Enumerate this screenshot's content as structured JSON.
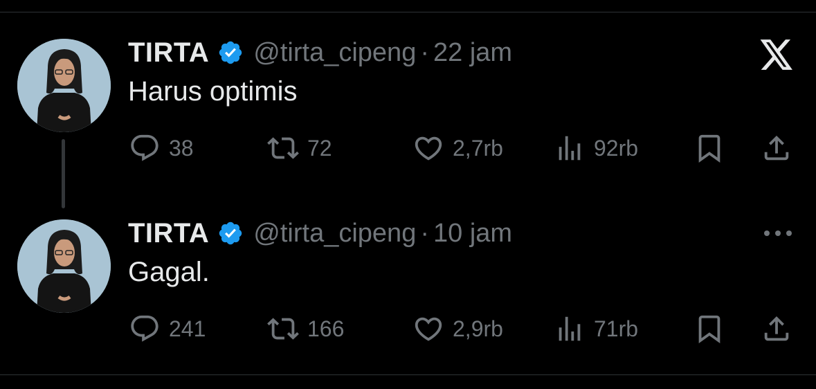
{
  "tweets": [
    {
      "author_name": "TIRTA",
      "handle": "@tirta_cipeng",
      "separator": "·",
      "time": "22 jam",
      "text": "Harus optimis",
      "replies": "38",
      "reposts": "72",
      "likes": "2,7rb",
      "views": "92rb",
      "corner_icon": "x-logo-icon"
    },
    {
      "author_name": "TIRTA",
      "handle": "@tirta_cipeng",
      "separator": "·",
      "time": "10 jam",
      "text": "Gagal.",
      "replies": "241",
      "reposts": "166",
      "likes": "2,9rb",
      "views": "71rb",
      "corner_icon": "more-options-icon"
    }
  ],
  "colors": {
    "background": "#000000",
    "primary_text": "#e7e9ea",
    "secondary_text": "#71767b",
    "verified_badge": "#1d9bf0",
    "avatar_background": "#a9c4d4"
  },
  "icons": [
    "reply-icon",
    "repost-icon",
    "like-icon",
    "views-icon",
    "bookmark-icon",
    "share-icon",
    "verified-badge-icon"
  ]
}
